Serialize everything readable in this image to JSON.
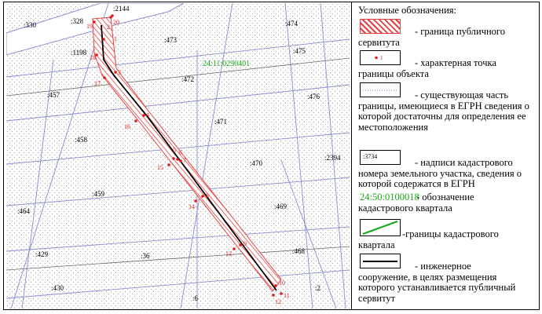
{
  "map": {
    "labels": [
      {
        "id": "lbl-328",
        "text": ":328"
      },
      {
        "id": "lbl-2144",
        "text": ":2144"
      },
      {
        "id": "lbl-330",
        "text": ":330"
      },
      {
        "id": "lbl-473",
        "text": ":473"
      },
      {
        "id": "lbl-474",
        "text": ":474"
      },
      {
        "id": "lbl-1198",
        "text": ":1198"
      },
      {
        "id": "lbl-475",
        "text": ":475"
      },
      {
        "id": "lbl-472",
        "text": ":472"
      },
      {
        "id": "lbl-457",
        "text": ":457"
      },
      {
        "id": "lbl-476",
        "text": ":476"
      },
      {
        "id": "lbl-471",
        "text": ":471"
      },
      {
        "id": "lbl-458",
        "text": ":458"
      },
      {
        "id": "lbl-2394",
        "text": ":2394"
      },
      {
        "id": "lbl-470",
        "text": ":470"
      },
      {
        "id": "lbl-459",
        "text": ":459"
      },
      {
        "id": "lbl-464",
        "text": ":464"
      },
      {
        "id": "lbl-469",
        "text": ":469"
      },
      {
        "id": "lbl-429",
        "text": ":429"
      },
      {
        "id": "lbl-36",
        "text": ":36"
      },
      {
        "id": "lbl-468",
        "text": ":468"
      },
      {
        "id": "lbl-430",
        "text": ":430"
      },
      {
        "id": "lbl-6",
        "text": ":6"
      },
      {
        "id": "lbl-2",
        "text": ":2"
      }
    ],
    "quarter_label": "24:11:0290401",
    "points": [
      "1",
      "2",
      "3",
      "4",
      "5",
      "6",
      "7",
      "8",
      "9",
      "10",
      "11",
      "12",
      "13",
      "14",
      "15",
      "16",
      "17",
      "18",
      "19",
      "20"
    ]
  },
  "legend": {
    "title": "Условные обозначения:",
    "point_symbol_label": "1",
    "number_symbol_label": ":3734",
    "quarter_example": "24:50:0100018",
    "items": [
      {
        "key": "servitude_boundary",
        "text_first": "- граница публичного",
        "text_rest": "сервитута"
      },
      {
        "key": "characteristic_point",
        "text_first": "- характерная точка",
        "text_rest": "границы объекта"
      },
      {
        "key": "existing_boundary",
        "text_first": "- существующая часть",
        "text_rest": "границы, имеющиеся в ЕГРН сведения о которой достаточны для определения ее местоположения"
      },
      {
        "key": "cadastral_number",
        "text_first": "- надписи кадастрового",
        "text_rest": "номера земельного участка, сведения о которой содержатся в ЕГРН"
      },
      {
        "key": "quarter_designation",
        "text_first": "- обозначение",
        "text_rest": "кадастрового квартала"
      },
      {
        "key": "quarter_boundary",
        "text_first": "-границы кадастрового",
        "text_rest": "квартала"
      },
      {
        "key": "engineering_structure",
        "text_first": "- инженерное",
        "text_rest": "сооружение, в целях размещения которого устанавливается публичный сервитут"
      }
    ]
  },
  "colors": {
    "point": "#e01b1b",
    "quarter": "#18a818",
    "hatch": "#e3413f",
    "line": "#000000",
    "parcel": "#7a7fc8"
  }
}
